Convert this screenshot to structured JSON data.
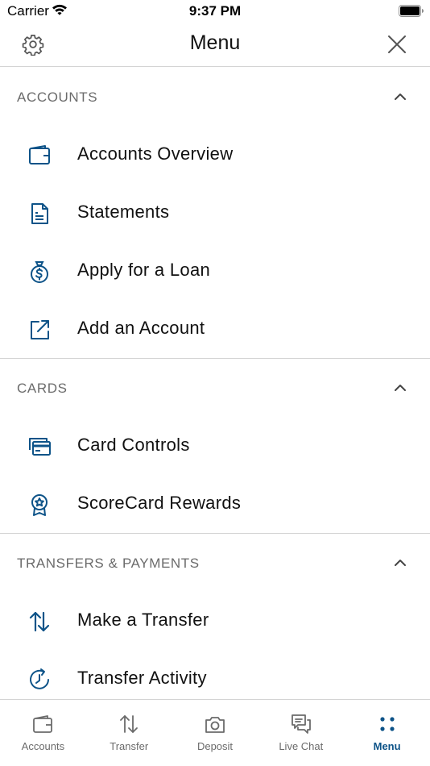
{
  "status_bar": {
    "carrier": "Carrier",
    "time": "9:37 PM"
  },
  "header": {
    "title": "Menu",
    "settings_icon": "gear-icon",
    "close_icon": "close-icon"
  },
  "colors": {
    "accent": "#0d5388",
    "divider": "#d4d4d4",
    "section_title": "#6b6b6b",
    "tab_inactive": "#6b6b6b"
  },
  "sections": [
    {
      "title": "ACCOUNTS",
      "expanded": true,
      "items": [
        {
          "label": "Accounts Overview",
          "icon": "wallet-icon"
        },
        {
          "label": "Statements",
          "icon": "document-icon"
        },
        {
          "label": "Apply for a Loan",
          "icon": "money-bag-icon"
        },
        {
          "label": "Add an Account",
          "icon": "external-link-icon"
        }
      ]
    },
    {
      "title": "CARDS",
      "expanded": true,
      "items": [
        {
          "label": "Card Controls",
          "icon": "cards-icon"
        },
        {
          "label": "ScoreCard Rewards",
          "icon": "award-ribbon-icon"
        }
      ]
    },
    {
      "title": "TRANSFERS & PAYMENTS",
      "expanded": true,
      "items": [
        {
          "label": "Make a Transfer",
          "icon": "transfer-arrows-icon"
        },
        {
          "label": "Transfer Activity",
          "icon": "history-clock-icon"
        }
      ]
    }
  ],
  "tab_bar": {
    "active": "Menu",
    "tabs": [
      {
        "label": "Accounts",
        "icon": "wallet-icon"
      },
      {
        "label": "Transfer",
        "icon": "transfer-arrows-icon"
      },
      {
        "label": "Deposit",
        "icon": "camera-icon"
      },
      {
        "label": "Live Chat",
        "icon": "chat-bubbles-icon"
      },
      {
        "label": "Menu",
        "icon": "menu-dots-icon"
      }
    ]
  }
}
